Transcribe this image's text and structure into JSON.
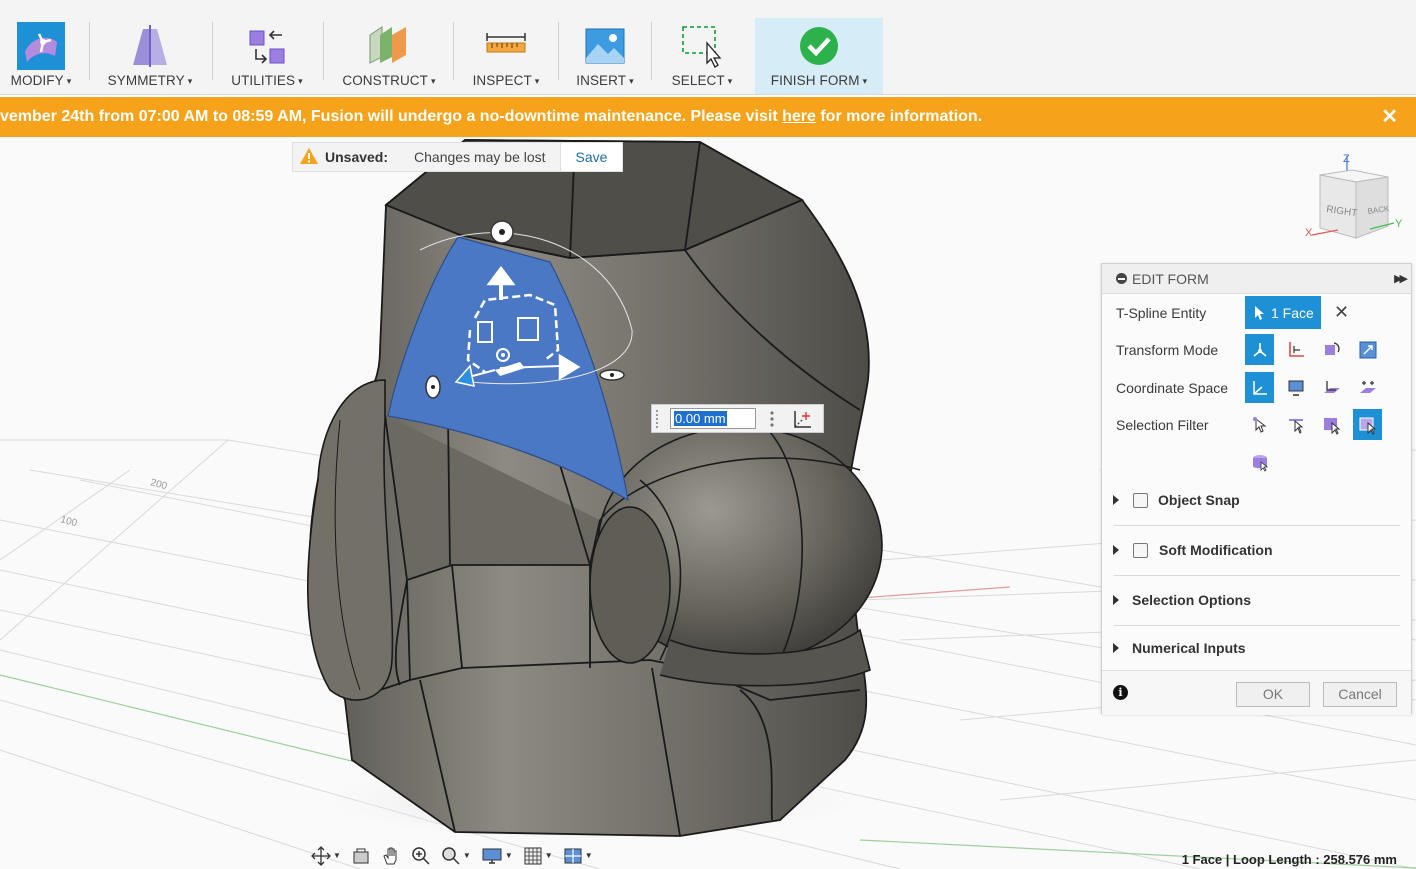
{
  "toolbar": {
    "groups": [
      {
        "label": "MODIFY",
        "icon": "modify-icon"
      },
      {
        "label": "SYMMETRY",
        "icon": "symmetry-icon"
      },
      {
        "label": "UTILITIES",
        "icon": "utilities-icon"
      },
      {
        "label": "CONSTRUCT",
        "icon": "construct-icon"
      },
      {
        "label": "INSPECT",
        "icon": "inspect-icon"
      },
      {
        "label": "INSERT",
        "icon": "insert-icon"
      },
      {
        "label": "SELECT",
        "icon": "select-icon"
      },
      {
        "label": "FINISH FORM",
        "icon": "finish-form-icon"
      }
    ],
    "caret": "▾"
  },
  "banner": {
    "text_before": "vember 24th from 07:00 AM to 08:59 AM, Fusion will undergo a no-downtime maintenance. Please visit ",
    "link_text": "here",
    "text_after": " for more information.",
    "close": "✕",
    "color": "#f7a21b"
  },
  "unsaved": {
    "label": "Unsaved:",
    "message": "Changes may be lost",
    "save": "Save"
  },
  "numeric_input": {
    "value": "0.00 mm"
  },
  "viewcube": {
    "front": "RIGHT",
    "side": "BACK",
    "z": "Z",
    "x": "X",
    "y": "Y"
  },
  "edit_form": {
    "title": "EDIT FORM",
    "expand": "▶▶",
    "rows": {
      "tspline_entity": "T-Spline Entity",
      "transform_mode": "Transform Mode",
      "coordinate_space": "Coordinate Space",
      "selection_filter": "Selection Filter"
    },
    "face_button": "1 Face",
    "clear": "✕",
    "sections": {
      "object_snap": "Object Snap",
      "soft_modification": "Soft Modification",
      "selection_options": "Selection Options",
      "numerical_inputs": "Numerical Inputs"
    },
    "ok": "OK",
    "cancel": "Cancel",
    "info": "i",
    "accent": "#1e91d6"
  },
  "status": {
    "text": "1 Face | Loop Length : 258.576 mm"
  },
  "grid_labels": [
    "200",
    "100"
  ]
}
